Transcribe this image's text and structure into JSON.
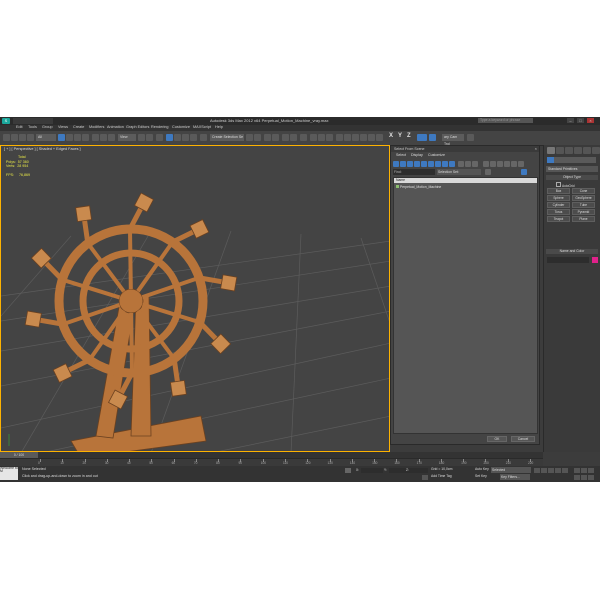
{
  "window": {
    "title": "Autodesk 3ds Max 2012 x64    Perpetual_Motion_Machine_vray.max",
    "search_placeholder": "Type a keyword or phrase",
    "logo": "S"
  },
  "menu": [
    "Edit",
    "Tools",
    "Group",
    "Views",
    "Create",
    "Modifiers",
    "Animation",
    "Graph Editors",
    "Rendering",
    "Customize",
    "MAXScript",
    "Help"
  ],
  "toolbar": {
    "selection_filter": "All",
    "view_dropdown": "View",
    "named_selection_set": "Create Selection Se",
    "axis_labels": [
      "X",
      "Y",
      "Z",
      "XY"
    ],
    "render_btn_label": "ary Cam Trol"
  },
  "viewport": {
    "label": "[ + ] [ Perspective ] [ Shaded + Edged Faces ]",
    "stats": {
      "total_label": "Total",
      "polys_label": "Polys:",
      "polys_value": "57 360",
      "verts_label": "Verts:",
      "verts_value": "28 954",
      "fps_label": "FPS:",
      "fps_value": "76,869"
    },
    "wood_color": "#b8743a"
  },
  "dialog": {
    "title": "Select From Scene",
    "close": "×",
    "menu": [
      "Select",
      "Display",
      "Customize"
    ],
    "find_label": "Find:",
    "selection_set_label": "Selection Set:",
    "column_header": "Name",
    "items": [
      "Perpetual_Motion_Machine"
    ],
    "ok_label": "OK",
    "cancel_label": "Cancel"
  },
  "command_panel": {
    "category_dropdown": "Standard Primitives",
    "object_type_label": "Object Type",
    "autogrid_label": "AutoGrid",
    "buttons": [
      "Box",
      "Cone",
      "Sphere",
      "GeoSphere",
      "Cylinder",
      "Tube",
      "Torus",
      "Pyramid",
      "Teapot",
      "Plane"
    ],
    "name_color_label": "Name and Color",
    "swatch_color": "#e0218a"
  },
  "timeline": {
    "slider_label": "0 / 100",
    "ticks": [
      "0",
      "10",
      "20",
      "30",
      "40",
      "50",
      "60",
      "70",
      "80",
      "90",
      "100",
      "110",
      "120",
      "130",
      "140",
      "150",
      "160",
      "170",
      "180",
      "190",
      "200",
      "210",
      "220"
    ]
  },
  "status": {
    "maxscript_label": "Welcome to M",
    "selection": "None Selected",
    "hint": "Click and drag-up-and-down to zoom in and out",
    "x_label": "X:",
    "y_label": "Y:",
    "z_label": "Z:",
    "grid": "Grid = 10,0cm",
    "add_time_tag": "Add Time Tag",
    "auto_key": "Auto Key",
    "auto_key_mode": "Selected",
    "set_key": "Set Key",
    "key_filters": "Key Filters..."
  }
}
